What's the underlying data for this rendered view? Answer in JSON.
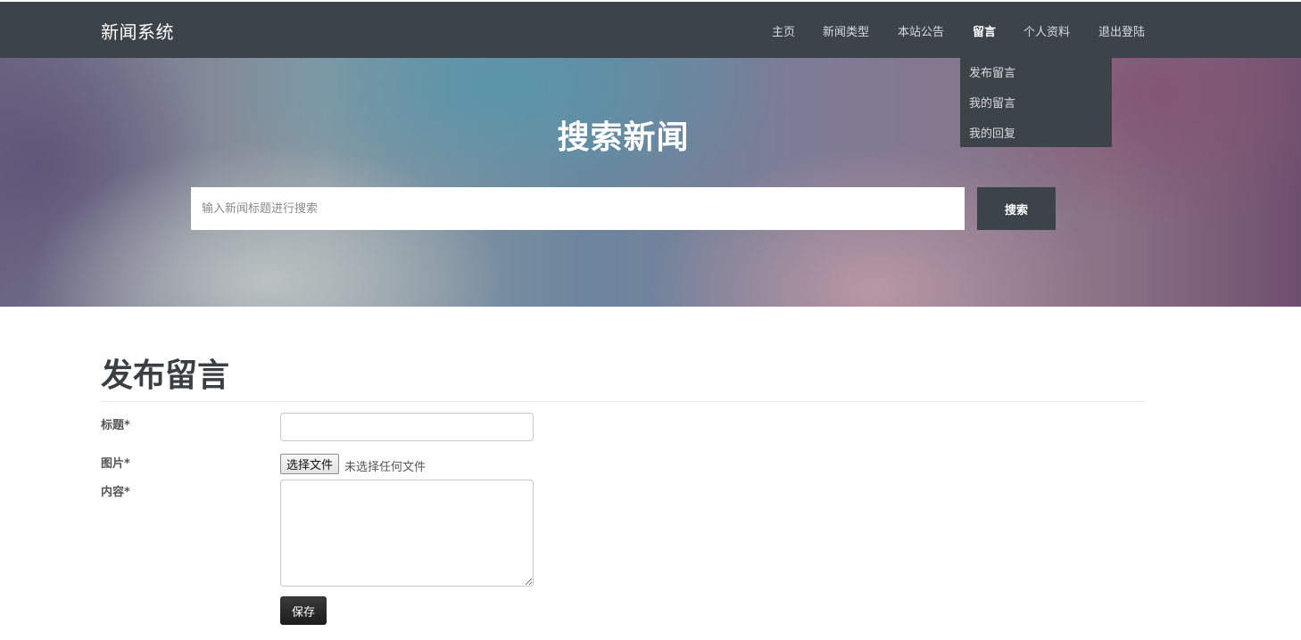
{
  "navbar": {
    "brand": "新闻系统",
    "items": [
      {
        "label": "主页"
      },
      {
        "label": "新闻类型"
      },
      {
        "label": "本站公告"
      },
      {
        "label": "留言"
      },
      {
        "label": "个人资料"
      },
      {
        "label": "退出登陆"
      }
    ],
    "active_item": "留言",
    "dropdown": [
      "发布留言",
      "我的留言",
      "我的回复"
    ]
  },
  "hero": {
    "title": "搜索新闻",
    "search_placeholder": "输入新闻标题进行搜索",
    "search_button": "搜索"
  },
  "form": {
    "title": "发布留言",
    "title_label": "标题*",
    "image_label": "图片*",
    "file_button": "选择文件",
    "file_status": "未选择任何文件",
    "content_label": "内容*",
    "save_button": "保存"
  },
  "colors": {
    "navbar": "#3c4349",
    "button_dark": "#222222"
  }
}
